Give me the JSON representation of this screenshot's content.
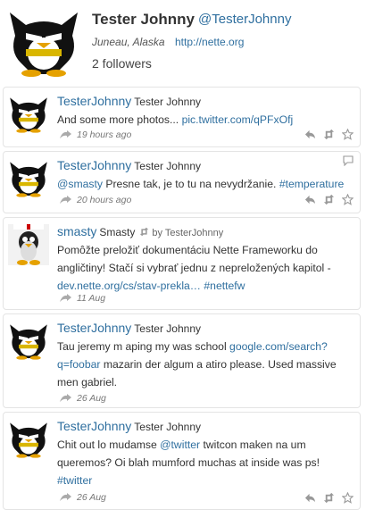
{
  "profile": {
    "name": "Tester Johnny",
    "handle": "@TesterJohnny",
    "location": "Juneau, Alaska",
    "url": "http://nette.org",
    "followers": "2 followers"
  },
  "tweets": [
    {
      "user": "TesterJohnny",
      "fullname": "Tester Johnny",
      "text1": "And some more photos... ",
      "link1": "pic.twitter.com/qPFxOfj",
      "time": "19 hours ago"
    },
    {
      "user": "TesterJohnny",
      "fullname": "Tester Johnny",
      "mention": "@smasty",
      "text1": " Presne tak, je to tu na nevydržanie. ",
      "hashtag": "#temperature",
      "time": "20 hours ago"
    },
    {
      "user": "smasty",
      "fullname": "Smasty",
      "retweet": "by TesterJohnny",
      "text1": "Pomôžte preložiť dokumentáciu Nette Frameworku do angličtiny! Stačí si vybrať jednu z nepreložených kapitol - ",
      "link1": "dev.nette.org/cs/stav-prekla…",
      "hashtag": "#nettefw",
      "time": "11 Aug"
    },
    {
      "user": "TesterJohnny",
      "fullname": "Tester Johnny",
      "text1": "Tau jeremy m aping my was school ",
      "link1": "google.com/search?q=foobar",
      "text2": " mazarin der algum a atiro please. Used massive men gabriel.",
      "time": "26 Aug"
    },
    {
      "user": "TesterJohnny",
      "fullname": "Tester Johnny",
      "text1": "Chit out lo mudamse ",
      "mention": "@twitter",
      "text2": " twitcon maken na um queremos? Oi blah mumford muchas at inside was ps! ",
      "hashtag": "#twitter",
      "time": "26 Aug"
    }
  ],
  "icons": [
    "reply-icon",
    "retweet-icon",
    "favorite-icon",
    "conversation-icon"
  ],
  "colors": {
    "link": "#2f6f9f",
    "border": "#e4e4e4"
  }
}
